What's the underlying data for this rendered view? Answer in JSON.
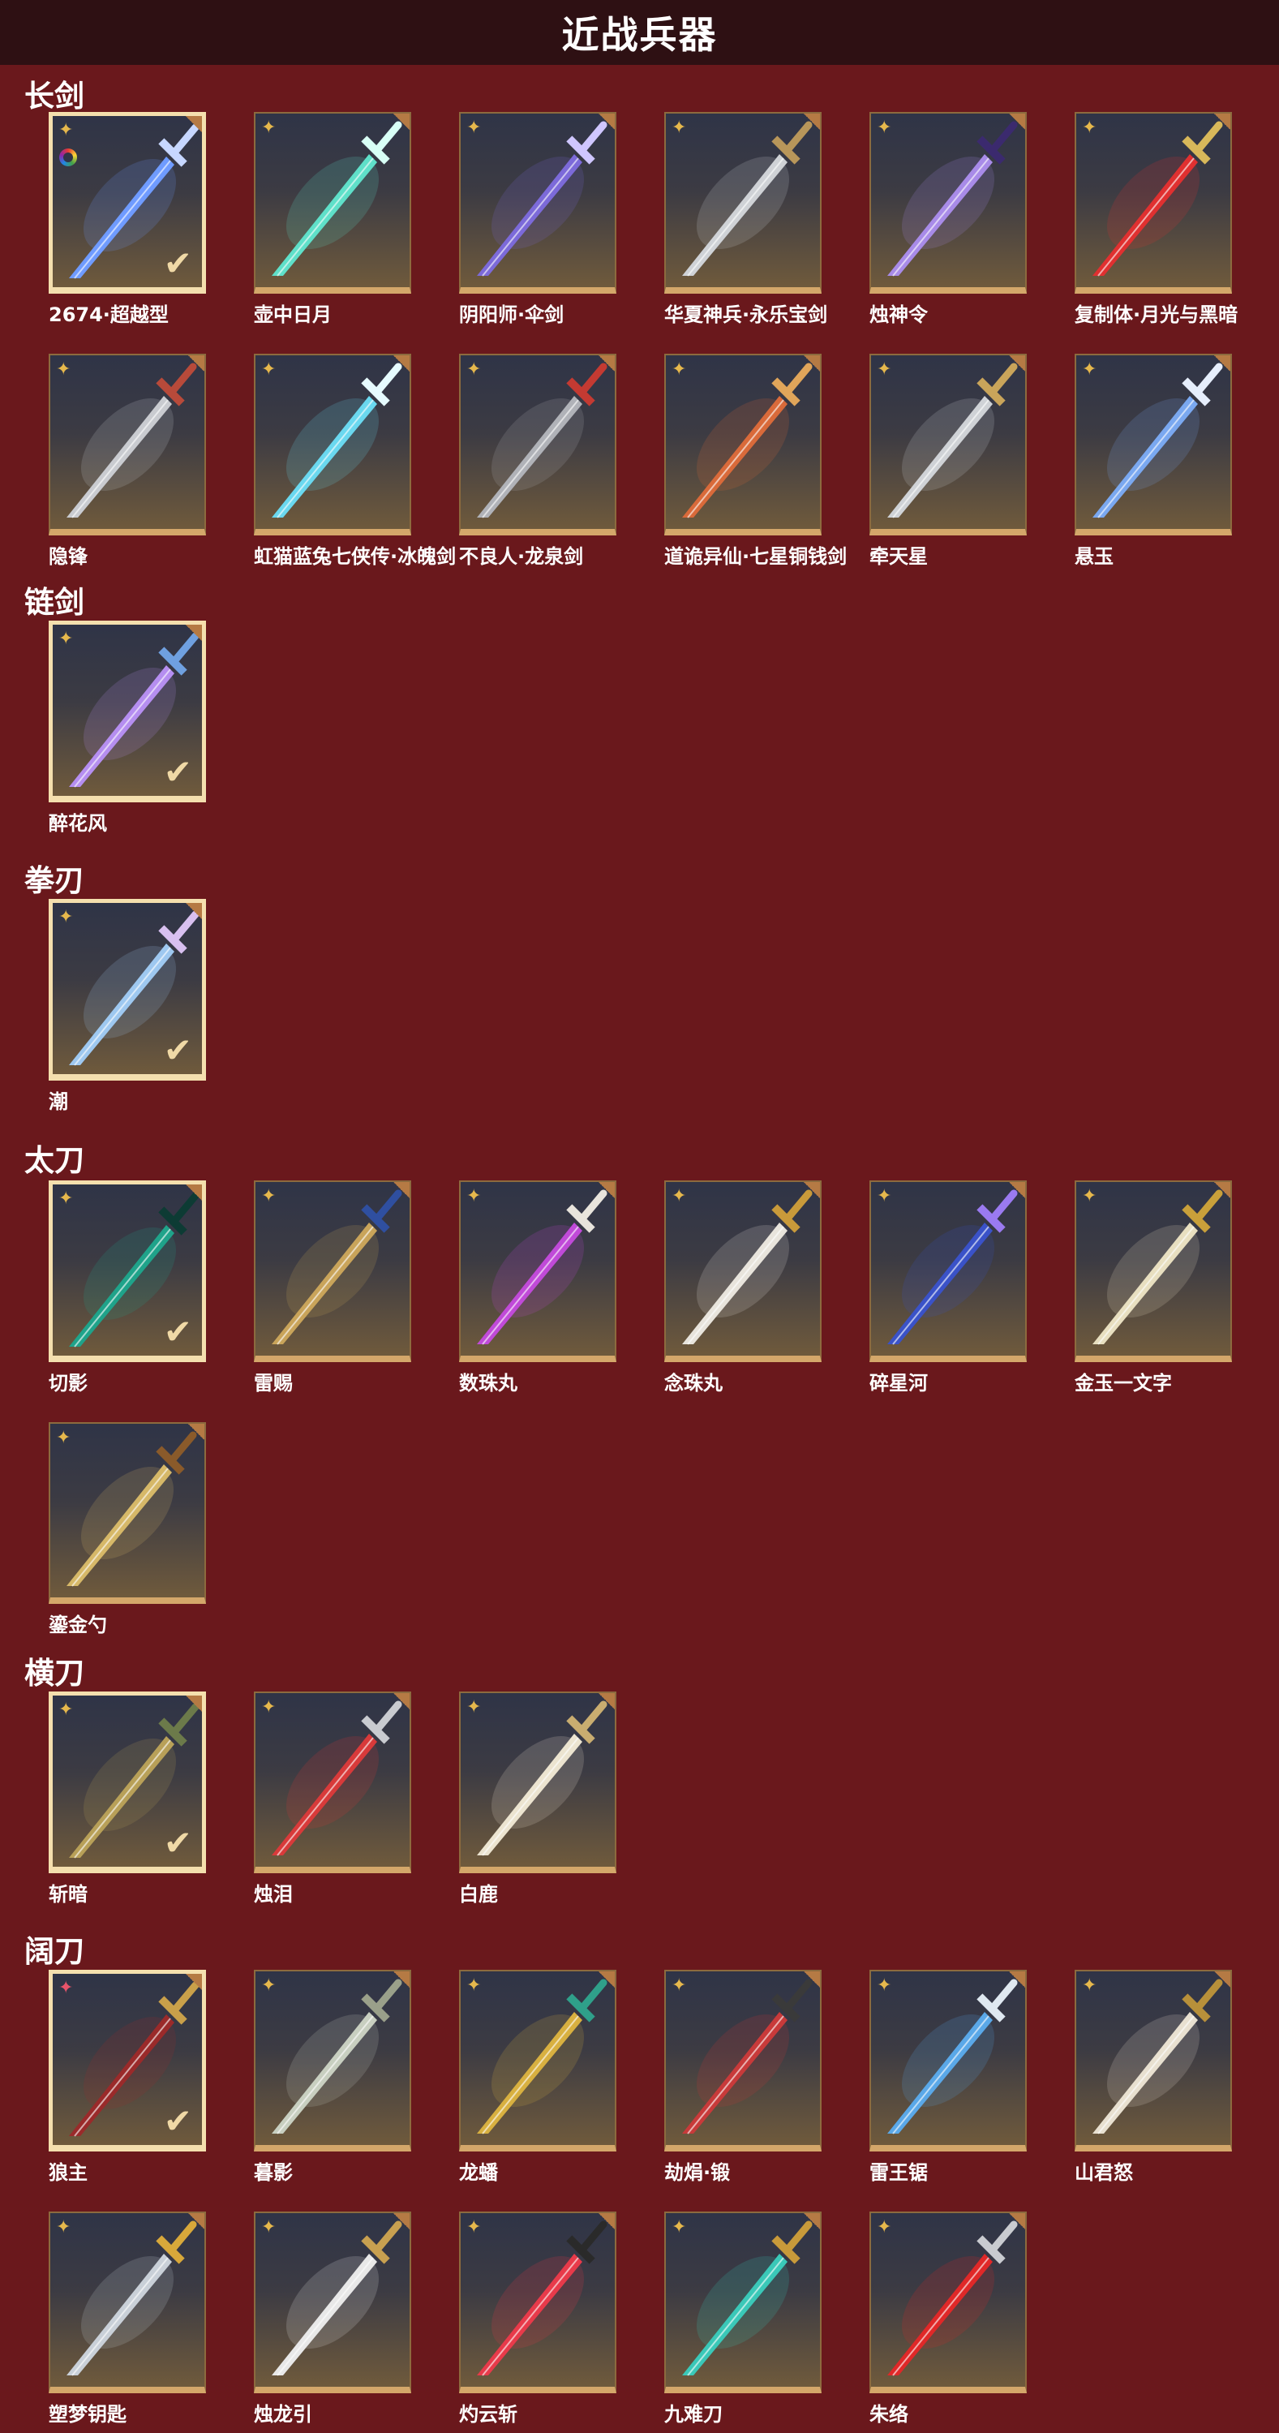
{
  "header": {
    "title": "近战兵器"
  },
  "categories": [
    {
      "name": "长剑",
      "items": [
        {
          "label": "2674·超越型",
          "selected": true,
          "color_ring": true,
          "badge": "gold",
          "colors": [
            "#6f9bff",
            "#c7d7ff"
          ]
        },
        {
          "label": "壶中日月",
          "badge": "gold",
          "colors": [
            "#5fe0c9",
            "#d8fff6"
          ]
        },
        {
          "label": "阴阳师·伞剑",
          "badge": "gold",
          "colors": [
            "#7c6ad9",
            "#cfc6ff"
          ]
        },
        {
          "label": "华夏神兵·永乐宝剑",
          "badge": "gold",
          "colors": [
            "#cfd2d6",
            "#b8965a"
          ]
        },
        {
          "label": "烛神令",
          "badge": "gold",
          "colors": [
            "#a88be8",
            "#3b2a6e"
          ]
        },
        {
          "label": "复制体·月光与黑暗",
          "badge": "gold",
          "colors": [
            "#e03030",
            "#d8b85a"
          ]
        },
        {
          "label": "隐锋",
          "badge": "gold",
          "colors": [
            "#c9cbd0",
            "#b84a3a"
          ]
        },
        {
          "label": "虹猫蓝兔七侠传·冰魄剑",
          "badge": "gold",
          "colors": [
            "#6ad8ef",
            "#e6fbff"
          ]
        },
        {
          "label": "不良人·龙泉剑",
          "badge": "gold",
          "colors": [
            "#b0b2b8",
            "#c43a32"
          ]
        },
        {
          "label": "道诡异仙·七星铜钱剑",
          "badge": "gold",
          "colors": [
            "#d96a3a",
            "#e0a55a"
          ]
        },
        {
          "label": "牵天星",
          "badge": "gold",
          "colors": [
            "#cfd2d6",
            "#c9a45a"
          ]
        },
        {
          "label": "悬玉",
          "badge": "gold",
          "colors": [
            "#7aa8f0",
            "#e6eefc"
          ]
        }
      ]
    },
    {
      "name": "链剑",
      "items": [
        {
          "label": "醉花风",
          "selected": true,
          "badge": "gold",
          "colors": [
            "#b58ef0",
            "#6fa0e0"
          ]
        }
      ]
    },
    {
      "name": "拳刃",
      "items": [
        {
          "label": "潮",
          "selected": true,
          "badge": "gold",
          "colors": [
            "#9ec8f0",
            "#d8c0f0"
          ]
        }
      ]
    },
    {
      "name": "太刀",
      "items": [
        {
          "label": "切影",
          "selected": true,
          "badge": "gold",
          "colors": [
            "#1fa38a",
            "#0d3b34"
          ]
        },
        {
          "label": "雷赐",
          "badge": "gold",
          "colors": [
            "#c9a45a",
            "#2f4fa0"
          ]
        },
        {
          "label": "数珠丸",
          "badge": "gold",
          "colors": [
            "#c04ad8",
            "#e8e4dc"
          ]
        },
        {
          "label": "念珠丸",
          "badge": "gold",
          "colors": [
            "#e8e4dc",
            "#c99a3a"
          ]
        },
        {
          "label": "碎星河",
          "badge": "gold",
          "colors": [
            "#3a52c8",
            "#9a7af0"
          ]
        },
        {
          "label": "金玉一文字",
          "badge": "gold",
          "colors": [
            "#e8dfc0",
            "#c9a03a"
          ]
        },
        {
          "label": "鎏金勺",
          "badge": "gold",
          "colors": [
            "#d6b868",
            "#8a5a2a"
          ]
        }
      ]
    },
    {
      "name": "横刀",
      "items": [
        {
          "label": "斩暗",
          "selected": true,
          "badge": "gold",
          "colors": [
            "#b8a058",
            "#6c7a4a"
          ]
        },
        {
          "label": "烛泪",
          "badge": "gold",
          "colors": [
            "#d83a3a",
            "#c9cbd0"
          ]
        },
        {
          "label": "白鹿",
          "badge": "gold",
          "colors": [
            "#ece4d0",
            "#c9ad70"
          ]
        }
      ]
    },
    {
      "name": "阔刀",
      "items": [
        {
          "label": "狼主",
          "selected": true,
          "badge": "pink",
          "colors": [
            "#9a2a2a",
            "#c9a04a"
          ]
        },
        {
          "label": "暮影",
          "badge": "gold",
          "colors": [
            "#c8cfc0",
            "#9aa08a"
          ]
        },
        {
          "label": "龙蟠",
          "badge": "gold",
          "colors": [
            "#d8b040",
            "#2fa08a"
          ]
        },
        {
          "label": "劫焆·锻",
          "badge": "gold",
          "colors": [
            "#c83a3a",
            "#3a3a3a"
          ]
        },
        {
          "label": "雷王锯",
          "badge": "gold",
          "colors": [
            "#5aa8e8",
            "#dfe8f0"
          ]
        },
        {
          "label": "山君怒",
          "badge": "gold",
          "colors": [
            "#e8e0d0",
            "#b8903a"
          ]
        },
        {
          "label": "塑梦钥匙",
          "badge": "gold",
          "colors": [
            "#c9d0d8",
            "#d8a83a"
          ]
        },
        {
          "label": "烛龙引",
          "badge": "gold",
          "colors": [
            "#e8e8e8",
            "#c8a050"
          ]
        },
        {
          "label": "灼云斩",
          "badge": "gold",
          "colors": [
            "#e83a4a",
            "#2a2a2a"
          ]
        },
        {
          "label": "九难刀",
          "badge": "gold",
          "colors": [
            "#3ac8b8",
            "#c89a3a"
          ]
        },
        {
          "label": "朱络",
          "badge": "gold",
          "colors": [
            "#e02828",
            "#c9cbd0"
          ]
        }
      ]
    }
  ]
}
